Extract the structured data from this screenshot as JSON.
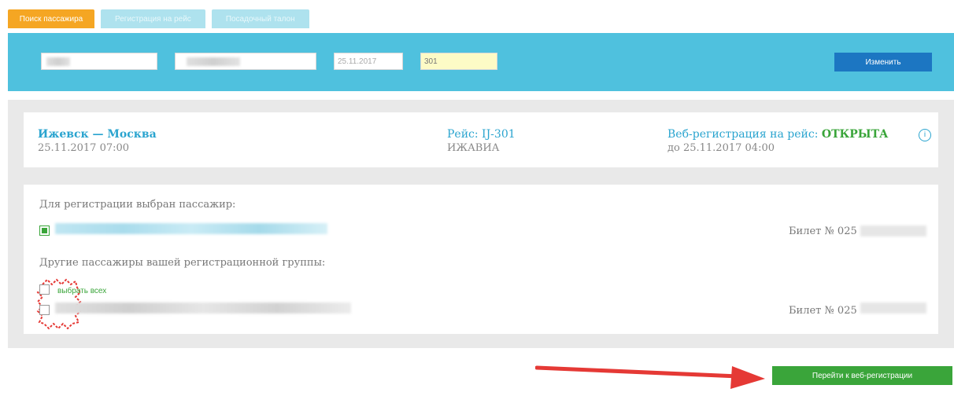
{
  "tabs": [
    {
      "label": "Поиск пассажира",
      "active": true
    },
    {
      "label": "Регистрация на рейс",
      "active": false
    },
    {
      "label": "Посадочный талон",
      "active": false
    }
  ],
  "search": {
    "date_value": "25.11.2017",
    "flight_value": "301",
    "change_label": "Изменить"
  },
  "flight": {
    "route": "Ижевск — Москва",
    "datetime": "25.11.2017 07:00",
    "flight_label": "Рейс: IJ-301",
    "airline": "ИЖАВИА",
    "web_status_label": "Веб-регистрация на рейс:",
    "web_status_value": "ОТКРЫТА",
    "web_deadline": "до 25.11.2017 04:00",
    "info_icon": "info-icon"
  },
  "passengers": {
    "selected_label": "Для регистрации выбран пассажир:",
    "selected_ticket": "Билет № 025",
    "others_label": "Другие пассажиры вашей регистрационной группы:",
    "select_all_label": "выбрать всех",
    "other_ticket": "Билет № 025"
  },
  "footer": {
    "go_label": "Перейти к веб-регистрации"
  },
  "colors": {
    "accent_orange": "#f5a623",
    "banner_blue": "#4fc1de",
    "button_blue": "#1c76c2",
    "green": "#3aa53a",
    "annotation_red": "#e53935"
  }
}
